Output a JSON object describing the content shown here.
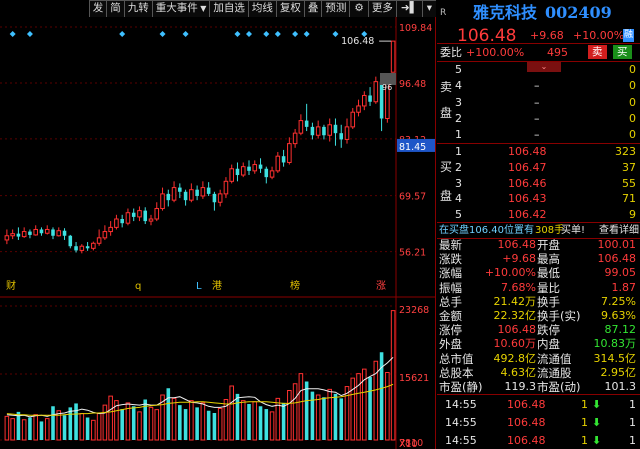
{
  "toolbar": {
    "items": [
      "发",
      "简",
      "九转",
      "重大事件",
      "加自选",
      "均线",
      "复权",
      "叠",
      "预测",
      "更多"
    ]
  },
  "price_axis": {
    "labels": [
      "109.84",
      "96.48",
      "83.12",
      "81.45",
      "69.57",
      "56.21"
    ]
  },
  "chart_tags": {
    "last_price": "106.48",
    "right_tag": "96",
    "low_tag": "81.45"
  },
  "events": {
    "labels": [
      "财",
      "q",
      "L",
      "港",
      "榜",
      "涨"
    ]
  },
  "volume_axis": {
    "labels": [
      "23268",
      "15621",
      "7810",
      "X10"
    ]
  },
  "header": {
    "badge": "R",
    "name": "雅克科技",
    "code": "002409",
    "price": "106.48",
    "change": "+9.68",
    "pct": "+10.00%",
    "market": "融"
  },
  "commission": {
    "label": "委比",
    "ratio": "+100.00%",
    "diff": "495",
    "sell_btn": "卖",
    "buy_btn": "买"
  },
  "sell_side": {
    "label": "卖盘",
    "rows": [
      {
        "n": "5",
        "p": "",
        "v": "0"
      },
      {
        "n": "4",
        "p": "–",
        "v": "0"
      },
      {
        "n": "3",
        "p": "–",
        "v": "0"
      },
      {
        "n": "2",
        "p": "–",
        "v": "0"
      },
      {
        "n": "1",
        "p": "–",
        "v": "0"
      }
    ]
  },
  "buy_side": {
    "label": "买盘",
    "rows": [
      {
        "n": "1",
        "p": "106.48",
        "v": "323"
      },
      {
        "n": "2",
        "p": "106.47",
        "v": "37"
      },
      {
        "n": "3",
        "p": "106.46",
        "v": "55"
      },
      {
        "n": "4",
        "p": "106.43",
        "v": "71"
      },
      {
        "n": "5",
        "p": "106.42",
        "v": "9"
      }
    ]
  },
  "order_info": {
    "prefix": "在买盘106.40位置有",
    "count": "308手",
    "suffix": "买单!",
    "link": "查看详细"
  },
  "stats": [
    {
      "l1": "最新",
      "v1": "106.48",
      "c1": "red",
      "l2": "开盘",
      "v2": "100.01",
      "c2": "red"
    },
    {
      "l1": "涨跌",
      "v1": "+9.68",
      "c1": "red",
      "l2": "最高",
      "v2": "106.48",
      "c2": "red"
    },
    {
      "l1": "涨幅",
      "v1": "+10.00%",
      "c1": "red",
      "l2": "最低",
      "v2": "99.05",
      "c2": "red"
    },
    {
      "l1": "振幅",
      "v1": "7.68%",
      "c1": "red",
      "l2": "量比",
      "v2": "1.87",
      "c2": "red"
    },
    {
      "l1": "总手",
      "v1": "21.42万",
      "c1": "yel",
      "l2": "换手",
      "v2": "7.25%",
      "c2": "yel"
    },
    {
      "l1": "金额",
      "v1": "22.32亿",
      "c1": "yel",
      "l2": "换手(实)",
      "v2": "9.63%",
      "c2": "yel"
    },
    {
      "l1": "涨停",
      "v1": "106.48",
      "c1": "red",
      "l2": "跌停",
      "v2": "87.12",
      "c2": "grn"
    },
    {
      "l1": "外盘",
      "v1": "10.60万",
      "c1": "red",
      "l2": "内盘",
      "v2": "10.83万",
      "c2": "grn"
    },
    {
      "l1": "总市值",
      "v1": "492.8亿",
      "c1": "yel",
      "l2": "流通值",
      "v2": "314.5亿",
      "c2": "yel"
    },
    {
      "l1": "总股本",
      "v1": "4.63亿",
      "c1": "yel",
      "l2": "流通股",
      "v2": "2.95亿",
      "c2": "yel"
    },
    {
      "l1": "市盈(静)",
      "v1": "119.3",
      "c1": "wht",
      "l2": "市盈(动)",
      "v2": "101.3",
      "c2": "wht"
    }
  ],
  "ticks": [
    {
      "time": "14:55",
      "price": "106.48",
      "vol": "1",
      "n": "1"
    },
    {
      "time": "14:55",
      "price": "106.48",
      "vol": "1",
      "n": "1"
    },
    {
      "time": "14:55",
      "price": "106.48",
      "vol": "1",
      "n": "1"
    }
  ],
  "chart_data": {
    "type": "candlestick",
    "y_range": [
      48,
      112
    ],
    "candles": [
      [
        59.0,
        60.0,
        61.5,
        58.0
      ],
      [
        60.0,
        60.5,
        61.5,
        59.2
      ],
      [
        60.5,
        59.8,
        62.0,
        59.0
      ],
      [
        59.8,
        61.0,
        62.0,
        59.5
      ],
      [
        61.0,
        60.2,
        61.5,
        59.4
      ],
      [
        60.2,
        61.5,
        62.5,
        60.0
      ],
      [
        61.5,
        60.6,
        62.0,
        60.0
      ],
      [
        60.6,
        61.5,
        62.5,
        60.3
      ],
      [
        61.5,
        60.0,
        62.0,
        59.2
      ],
      [
        60.0,
        61.2,
        62.0,
        59.8
      ],
      [
        61.2,
        60.0,
        61.8,
        59.0
      ],
      [
        60.0,
        57.5,
        60.2,
        57.0
      ],
      [
        57.5,
        56.5,
        58.5,
        56.0
      ],
      [
        56.5,
        57.5,
        58.0,
        55.8
      ],
      [
        57.5,
        57.0,
        58.5,
        56.4
      ],
      [
        57.0,
        58.2,
        58.6,
        56.5
      ],
      [
        58.2,
        59.5,
        61.5,
        57.6
      ],
      [
        59.5,
        61.0,
        62.5,
        59.0
      ],
      [
        61.0,
        62.0,
        63.5,
        60.0
      ],
      [
        62.0,
        64.0,
        65.0,
        61.5
      ],
      [
        64.0,
        63.0,
        65.0,
        62.0
      ],
      [
        63.0,
        65.5,
        66.5,
        62.5
      ],
      [
        65.5,
        64.5,
        66.5,
        63.5
      ],
      [
        64.5,
        66.0,
        67.0,
        63.5
      ],
      [
        66.0,
        63.5,
        66.8,
        62.8
      ],
      [
        63.5,
        64.0,
        65.0,
        62.5
      ],
      [
        64.0,
        66.5,
        68.0,
        63.5
      ],
      [
        66.5,
        70.0,
        71.5,
        66.0
      ],
      [
        70.0,
        68.5,
        71.0,
        67.0
      ],
      [
        68.5,
        71.5,
        73.0,
        68.0
      ],
      [
        71.5,
        70.5,
        72.5,
        69.0
      ],
      [
        70.5,
        68.5,
        71.0,
        67.2
      ],
      [
        68.5,
        71.0,
        72.5,
        68.0
      ],
      [
        71.0,
        69.5,
        72.0,
        68.5
      ],
      [
        69.5,
        71.5,
        73.0,
        68.8
      ],
      [
        71.5,
        70.0,
        72.8,
        69.5
      ],
      [
        70.0,
        68.0,
        70.5,
        66.0
      ],
      [
        68.0,
        70.0,
        71.0,
        67.0
      ],
      [
        70.0,
        73.0,
        74.0,
        69.0
      ],
      [
        73.0,
        76.0,
        77.0,
        72.5
      ],
      [
        76.0,
        74.5,
        77.5,
        73.0
      ],
      [
        74.5,
        76.5,
        77.5,
        74.0
      ],
      [
        76.5,
        75.5,
        78.0,
        74.5
      ],
      [
        75.5,
        77.0,
        78.0,
        74.8
      ],
      [
        77.0,
        76.0,
        78.5,
        75.0
      ],
      [
        76.0,
        74.0,
        76.5,
        72.5
      ],
      [
        74.0,
        75.5,
        76.5,
        73.5
      ],
      [
        75.5,
        79.0,
        80.0,
        75.0
      ],
      [
        79.0,
        77.5,
        80.5,
        76.5
      ],
      [
        77.5,
        82.0,
        83.5,
        77.0
      ],
      [
        82.0,
        84.5,
        85.5,
        81.0
      ],
      [
        84.5,
        87.5,
        89.0,
        84.0
      ],
      [
        87.5,
        86.0,
        91.5,
        85.0
      ],
      [
        86.0,
        84.0,
        87.0,
        83.0
      ],
      [
        84.0,
        86.0,
        87.5,
        83.2
      ],
      [
        86.0,
        84.0,
        86.5,
        83.0
      ],
      [
        84.0,
        86.5,
        88.0,
        82.5
      ],
      [
        86.5,
        84.5,
        88.0,
        81.5
      ],
      [
        84.5,
        83.0,
        86.5,
        81.0
      ],
      [
        83.0,
        86.0,
        88.0,
        82.0
      ],
      [
        86.0,
        89.5,
        90.5,
        85.5
      ],
      [
        89.5,
        91.0,
        92.5,
        88.5
      ],
      [
        91.0,
        93.5,
        94.5,
        90.0
      ],
      [
        93.5,
        92.0,
        95.5,
        91.0
      ],
      [
        92.0,
        96.8,
        98.0,
        91.5
      ],
      [
        96.8,
        88.0,
        96.8,
        85.0
      ],
      [
        88.0,
        96.48,
        97.5,
        87.0
      ],
      [
        99.05,
        106.48,
        106.48,
        99.05
      ]
    ],
    "volumes": [
      42,
      38,
      50,
      36,
      40,
      45,
      33,
      38,
      60,
      52,
      44,
      58,
      65,
      47,
      40,
      35,
      48,
      62,
      78,
      70,
      55,
      66,
      60,
      50,
      72,
      58,
      54,
      80,
      92,
      74,
      62,
      55,
      70,
      58,
      66,
      52,
      48,
      56,
      72,
      96,
      82,
      70,
      64,
      68,
      60,
      55,
      50,
      74,
      66,
      88,
      100,
      118,
      104,
      86,
      80,
      76,
      90,
      82,
      74,
      95,
      110,
      118,
      126,
      112,
      140,
      156,
      120,
      230
    ],
    "ma5": [
      45,
      44,
      43,
      44,
      41,
      43,
      44,
      42,
      45,
      47,
      48,
      51,
      52,
      55,
      53,
      49,
      47,
      48,
      54,
      61,
      63,
      64,
      63,
      62,
      64,
      62,
      62,
      68,
      75,
      75,
      77,
      72,
      67,
      66,
      64,
      60,
      58,
      58,
      60,
      67,
      75,
      76,
      77,
      76,
      68,
      63,
      60,
      62,
      60,
      65,
      74,
      88,
      91,
      91,
      91,
      89,
      86,
      85,
      79,
      83,
      90,
      97,
      107,
      113,
      118,
      129,
      137,
      147
    ],
    "ma10": [
      47,
      46,
      45,
      45,
      44,
      44,
      44,
      44,
      44,
      44,
      45,
      46,
      46,
      47,
      47,
      48,
      48,
      49,
      50,
      52,
      54,
      56,
      57,
      58,
      60,
      61,
      62,
      63,
      65,
      66,
      67,
      67,
      67,
      68,
      68,
      67,
      66,
      65,
      64,
      64,
      66,
      67,
      68,
      68,
      68,
      68,
      67,
      66,
      65,
      65,
      66,
      68,
      70,
      71,
      72,
      74,
      75,
      76,
      77,
      79,
      81,
      83,
      85,
      87,
      89,
      92,
      95,
      99
    ]
  }
}
